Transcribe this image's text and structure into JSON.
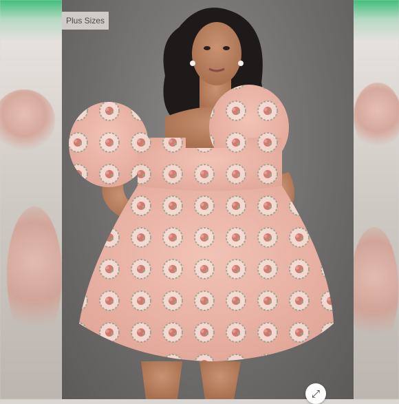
{
  "badge": {
    "label": "Plus Sizes"
  },
  "controls": {
    "expand_icon": "expand-icon",
    "expand_glyph": "⤢"
  },
  "colors": {
    "backdrop": "#6f6e6c",
    "dress_pink": "#e9b2a6",
    "accent_green": "#3fbf7a"
  }
}
